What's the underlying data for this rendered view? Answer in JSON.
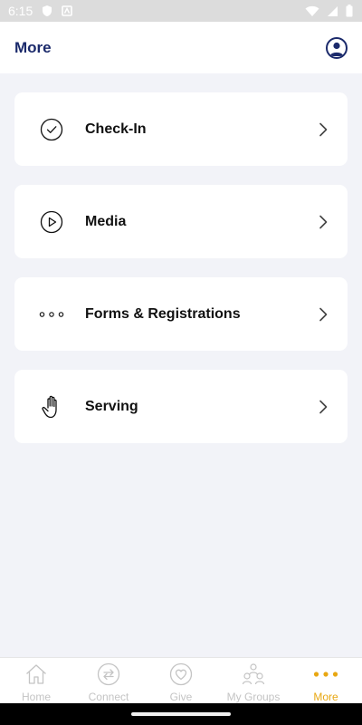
{
  "status_bar": {
    "time": "6:15",
    "icons": [
      "shield-icon",
      "notification-icon",
      "wifi-icon",
      "signal-icon",
      "battery-icon"
    ]
  },
  "header": {
    "title": "More",
    "profile_icon": "account-circle-icon"
  },
  "menu": {
    "items": [
      {
        "label": "Check-In",
        "icon": "check-circle-icon"
      },
      {
        "label": "Media",
        "icon": "play-circle-icon"
      },
      {
        "label": "Forms & Registrations",
        "icon": "dots-icon"
      },
      {
        "label": "Serving",
        "icon": "hand-icon"
      }
    ],
    "chevron_icon": "chevron-right-icon"
  },
  "bottom_nav": {
    "items": [
      {
        "label": "Home",
        "icon": "home-icon",
        "active": false
      },
      {
        "label": "Connect",
        "icon": "connect-icon",
        "active": false
      },
      {
        "label": "Give",
        "icon": "heart-icon",
        "active": false
      },
      {
        "label": "My Groups",
        "icon": "groups-icon",
        "active": false
      },
      {
        "label": "More",
        "icon": "more-dots-icon",
        "active": true
      }
    ]
  },
  "colors": {
    "brand_navy": "#1b2a6b",
    "active_accent": "#e8a712",
    "inactive_gray": "#c4c4c4",
    "background": "#f2f3f8"
  }
}
